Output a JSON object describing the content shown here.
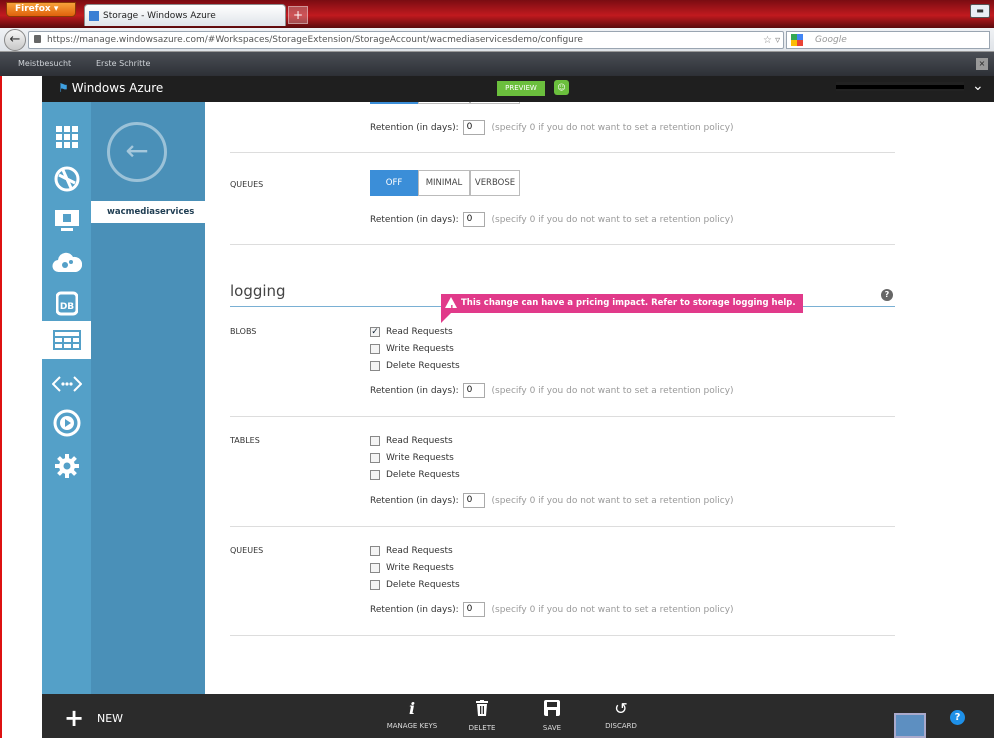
{
  "browser": {
    "app_button": "Firefox",
    "tab_title": "Storage - Windows Azure",
    "url": "https://manage.windowsazure.com/#Workspaces/StorageExtension/StorageAccount/wacmediaservicesdemo/configure",
    "search_placeholder": "Google",
    "bookmarks": [
      "Meistbesucht",
      "Erste Schritte"
    ]
  },
  "portal": {
    "logo": "Windows Azure",
    "preview_badge": "PREVIEW",
    "selected_item": "wacmediaservices"
  },
  "sidebar_icons": [
    "all-items-icon",
    "web-sites-icon",
    "virtual-machines-icon",
    "cloud-services-icon",
    "sql-databases-icon",
    "storage-icon",
    "networks-icon",
    "media-services-icon",
    "settings-icon"
  ],
  "monitoring_queues": {
    "label": "QUEUES",
    "options": [
      "OFF",
      "MINIMAL",
      "VERBOSE"
    ],
    "selected": "OFF"
  },
  "retention": {
    "label": "Retention (in days):",
    "value": "0",
    "note": "(specify 0 if you do not want to set a retention policy)"
  },
  "logging": {
    "title": "logging",
    "warning": "This change can have a pricing impact. Refer to storage logging help.",
    "sections": [
      {
        "label": "BLOBS",
        "read": "Read Requests",
        "write": "Write Requests",
        "delete": "Delete Requests",
        "read_checked": true
      },
      {
        "label": "TABLES",
        "read": "Read Requests",
        "write": "Write Requests",
        "delete": "Delete Requests",
        "read_checked": false
      },
      {
        "label": "QUEUES",
        "read": "Read Requests",
        "write": "Write Requests",
        "delete": "Delete Requests",
        "read_checked": false
      }
    ]
  },
  "bottom_bar": {
    "new_label": "NEW",
    "actions": [
      {
        "label": "MANAGE KEYS",
        "icon": "info-icon"
      },
      {
        "label": "DELETE",
        "icon": "trash-icon"
      },
      {
        "label": "SAVE",
        "icon": "save-icon"
      },
      {
        "label": "DISCARD",
        "icon": "undo-icon"
      }
    ],
    "help": "?"
  }
}
